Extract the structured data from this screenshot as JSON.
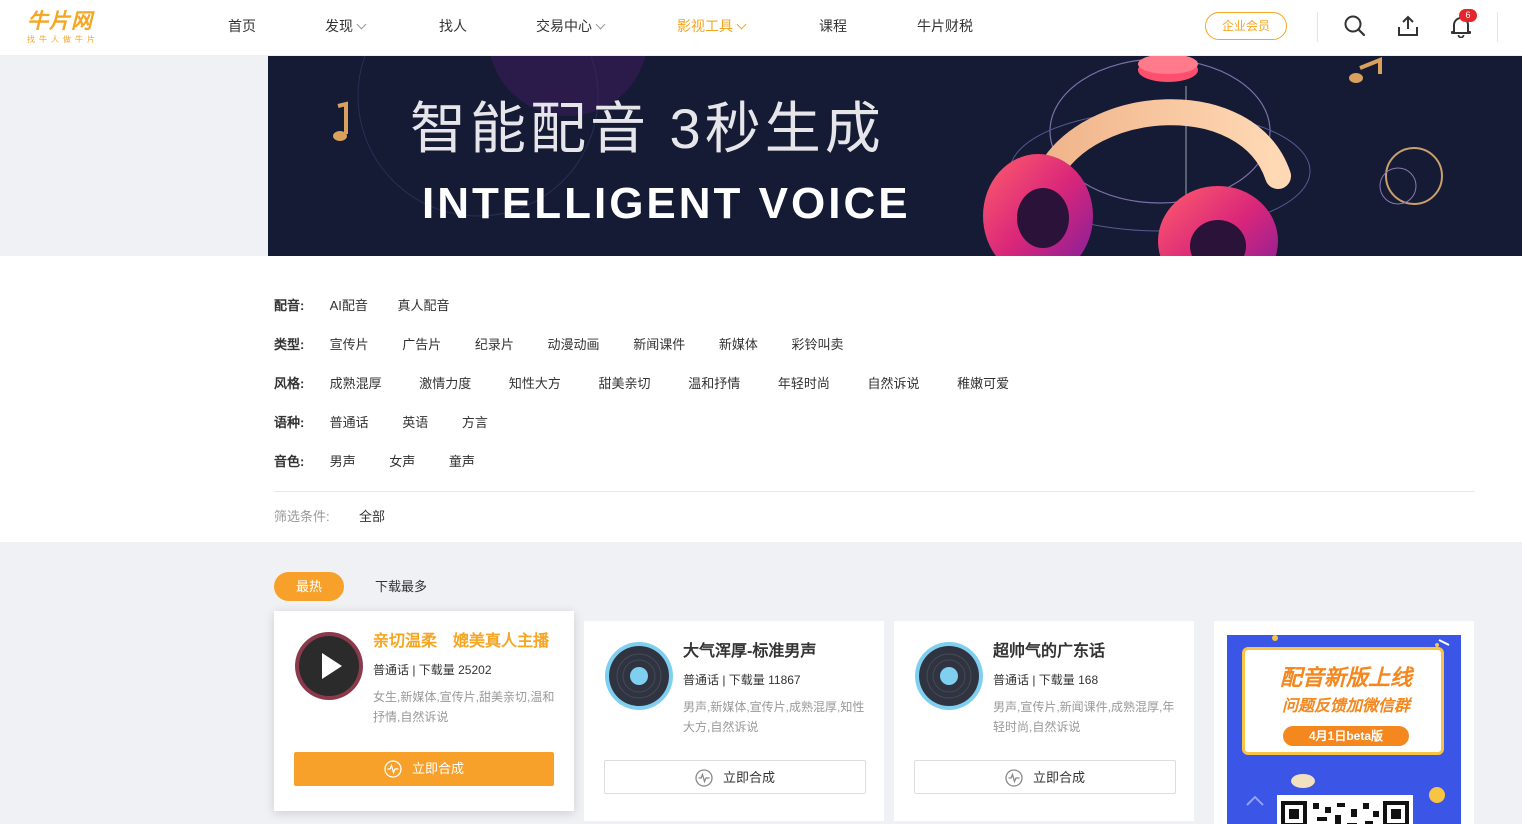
{
  "header": {
    "logo_text": "牛片网",
    "logo_tagline": "找牛人做牛片",
    "nav": [
      {
        "label": "首页",
        "dropdown": false,
        "active": false
      },
      {
        "label": "发现",
        "dropdown": true,
        "active": false
      },
      {
        "label": "找人",
        "dropdown": false,
        "active": false
      },
      {
        "label": "交易中心",
        "dropdown": true,
        "active": false
      },
      {
        "label": "影视工具",
        "dropdown": true,
        "active": true
      },
      {
        "label": "课程",
        "dropdown": false,
        "active": false
      },
      {
        "label": "牛片财税",
        "dropdown": false,
        "active": false
      }
    ],
    "vip_label": "企业会员",
    "notification_count": "6",
    "icons": [
      "search-icon",
      "upload-icon",
      "bell-icon"
    ]
  },
  "banner": {
    "title": "智能配音 3秒生成",
    "subtitle": "INTELLIGENT VOICE"
  },
  "filters": {
    "rows": [
      {
        "label": "配音:",
        "options": [
          "AI配音",
          "真人配音"
        ]
      },
      {
        "label": "类型:",
        "options": [
          "宣传片",
          "广告片",
          "纪录片",
          "动漫动画",
          "新闻课件",
          "新媒体",
          "彩铃叫卖"
        ]
      },
      {
        "label": "风格:",
        "options": [
          "成熟混厚",
          "激情力度",
          "知性大方",
          "甜美亲切",
          "温和抒情",
          "年轻时尚",
          "自然诉说",
          "稚嫩可爱"
        ]
      },
      {
        "label": "语种:",
        "options": [
          "普通话",
          "英语",
          "方言"
        ]
      },
      {
        "label": "音色:",
        "options": [
          "男声",
          "女声",
          "童声"
        ]
      }
    ],
    "condition_label": "筛选条件:",
    "condition_value": "全部"
  },
  "sort_tabs": {
    "hot": "最热",
    "most_downloads": "下载最多"
  },
  "cards": [
    {
      "title": "亲切温柔　媲美真人主播",
      "meta": "普通话 | 下载量 25202",
      "tags": "女生,新媒体,宣传片,甜美亲切,温和抒情,自然诉说",
      "button": "立即合成"
    },
    {
      "title": "大气浑厚-标准男声",
      "meta": "普通话 | 下载量 11867",
      "tags": "男声,新媒体,宣传片,成熟混厚,知性大方,自然诉说",
      "button": "立即合成"
    },
    {
      "title": "超帅气的广东话",
      "meta": "普通话 | 下载量 168",
      "tags": "男声,宣传片,新闻课件,成熟混厚,年轻时尚,自然诉说",
      "button": "立即合成"
    }
  ],
  "promo": {
    "title": "配音新版上线",
    "subtitle": "问题反馈加微信群",
    "pill": "4月1日beta版"
  },
  "colors": {
    "accent": "#f7a12a",
    "banner_bg": "#151a35",
    "promo_bg": "#3b55e6",
    "badge": "#e4262c"
  }
}
